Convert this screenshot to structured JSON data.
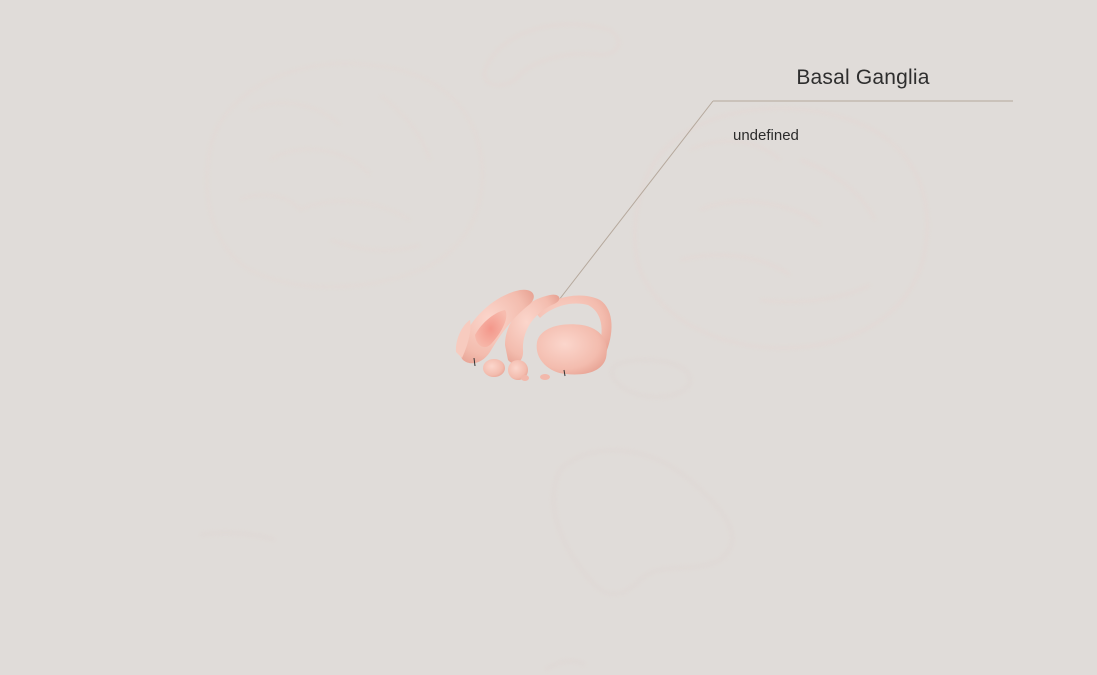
{
  "annotation": {
    "title": "Basal Ganglia",
    "description": "undefined"
  },
  "colors": {
    "background": "#e0dcd9",
    "structure_fill": "#f6c7bb",
    "structure_highlight": "#f39b8f",
    "leader_line": "#b5a89c"
  },
  "icons": {
    "model": "basal-ganglia-3d-model",
    "ghost_brain": "brain-outline-ghost"
  }
}
